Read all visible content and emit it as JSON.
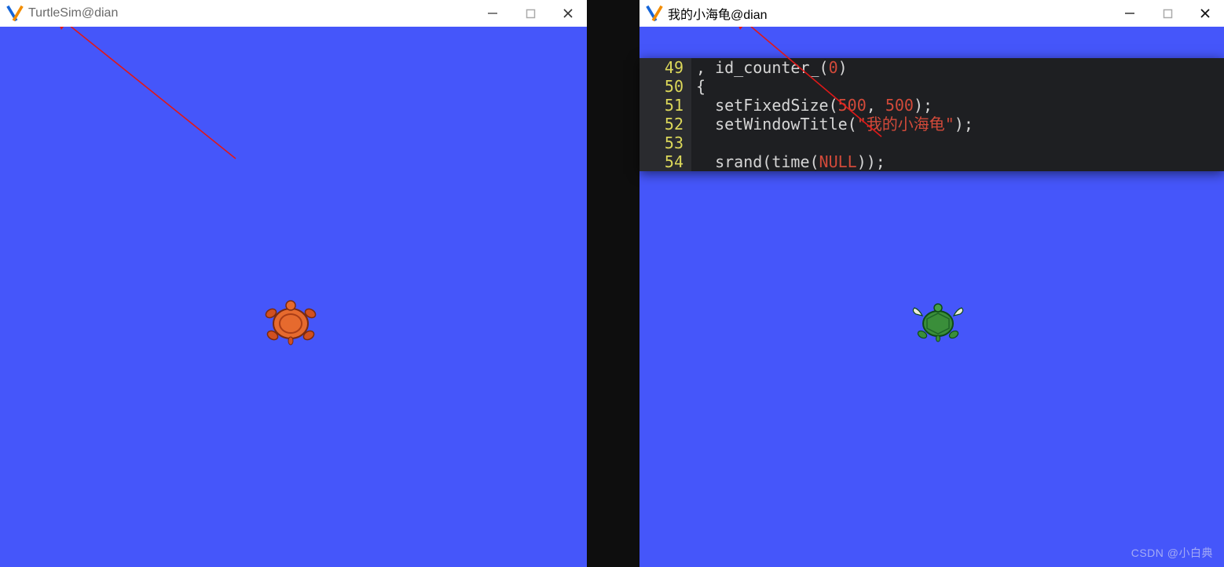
{
  "left_window": {
    "title": "TurtleSim@dian"
  },
  "right_window": {
    "title": "我的小海龟@dian"
  },
  "code": {
    "lines": [
      {
        "num": "49",
        "pre": ", ",
        "fn": "id_counter_",
        "open": "(",
        "args": [
          "0"
        ],
        "close": ")",
        "tail": ""
      },
      {
        "num": "50",
        "plain": "{"
      },
      {
        "num": "51",
        "pre": "  ",
        "fn": "setFixedSize",
        "open": "(",
        "args": [
          "500",
          ", ",
          "500"
        ],
        "close": ");"
      },
      {
        "num": "52",
        "pre": "  ",
        "fn": "setWindowTitle",
        "open": "(",
        "str": "\"我的小海龟\"",
        "close": ");"
      },
      {
        "num": "53",
        "plain": ""
      },
      {
        "num": "54",
        "pre": "  ",
        "fn": "srand",
        "open": "(",
        "inner_fn": "time",
        "inner_open": "(",
        "kw": "NULL",
        "inner_close": ")",
        "close": ");"
      }
    ]
  },
  "watermark": "CSDN @小白典"
}
